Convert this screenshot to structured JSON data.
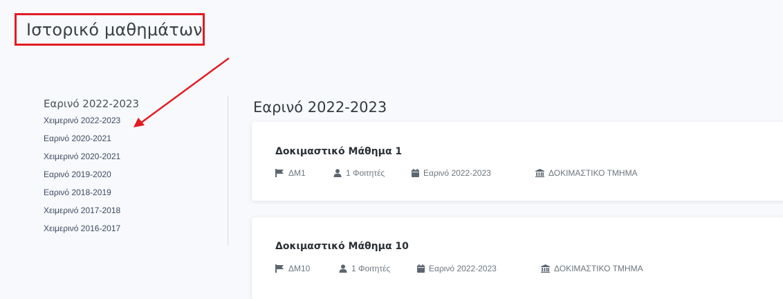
{
  "page": {
    "title": "Ιστορικό μαθημάτων"
  },
  "sidebar": {
    "active": "Εαρινό 2022-2023",
    "items": [
      "Χειμερινό 2022-2023",
      "Εαρινό 2020-2021",
      "Χειμερινό 2020-2021",
      "Εαρινό 2019-2020",
      "Εαρινό 2018-2019",
      "Χειμερινό 2017-2018",
      "Χειμερινό 2016-2017"
    ]
  },
  "main": {
    "section_title": "Εαρινό 2022-2023",
    "courses": [
      {
        "title": "Δοκιμαστικό Μάθημα 1",
        "code": "ΔΜ1",
        "students": "1 Φοιτητές",
        "semester": "Εαρινό 2022-2023",
        "department": "ΔΟΚΙΜΑΣΤΙΚΟ ΤΜΗΜΑ"
      },
      {
        "title": "Δοκιμαστικό Μάθημα 10",
        "code": "ΔΜ10",
        "students": "1 Φοιτητές",
        "semester": "Εαρινό 2022-2023",
        "department": "ΔΟΚΙΜΑΣΤΙΚΟ ΤΜΗΜΑ"
      }
    ]
  },
  "icons": {
    "code": "flag-icon",
    "students": "user-icon",
    "semester": "calendar-icon",
    "department": "institution-icon"
  },
  "colors": {
    "annotation": "#e31b23",
    "link": "#3d4a63",
    "card_bg": "#ffffff",
    "page_bg": "#f7f9fc"
  }
}
